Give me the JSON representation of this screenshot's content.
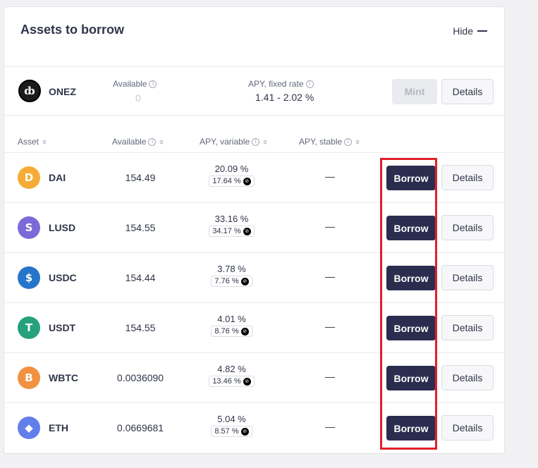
{
  "header": {
    "title": "Assets to borrow",
    "hide_label": "Hide"
  },
  "onez": {
    "symbol": "ONEZ",
    "logo_letter": "ȸ",
    "available_label": "Available",
    "available_value": "0",
    "apy_label": "APY, fixed rate",
    "apy_value": "1.41 - 2.02 %",
    "mint_label": "Mint",
    "details_label": "Details"
  },
  "columns": {
    "asset": "Asset",
    "available": "Available",
    "apy_variable": "APY, variable",
    "apy_stable": "APY, stable"
  },
  "rows": [
    {
      "symbol": "DAI",
      "available": "154.49",
      "apy": "20.09 %",
      "apy_badge": "17.64 %",
      "stable": "—",
      "borrow": "Borrow",
      "details": "Details",
      "icon_color": "#f5ac37",
      "icon_glyph": "D"
    },
    {
      "symbol": "LUSD",
      "available": "154.55",
      "apy": "33.16 %",
      "apy_badge": "34.17 %",
      "stable": "—",
      "borrow": "Borrow",
      "details": "Details",
      "icon_color": "#7b6bd8",
      "icon_glyph": "S"
    },
    {
      "symbol": "USDC",
      "available": "154.44",
      "apy": "3.78 %",
      "apy_badge": "7.76 %",
      "stable": "—",
      "borrow": "Borrow",
      "details": "Details",
      "icon_color": "#2775ca",
      "icon_glyph": "$"
    },
    {
      "symbol": "USDT",
      "available": "154.55",
      "apy": "4.01 %",
      "apy_badge": "8.76 %",
      "stable": "—",
      "borrow": "Borrow",
      "details": "Details",
      "icon_color": "#26a17b",
      "icon_glyph": "T"
    },
    {
      "symbol": "WBTC",
      "available": "0.0036090",
      "apy": "4.82 %",
      "apy_badge": "13.46 %",
      "stable": "—",
      "borrow": "Borrow",
      "details": "Details",
      "icon_color": "#f09242",
      "icon_glyph": "B"
    },
    {
      "symbol": "ETH",
      "available": "0.0669681",
      "apy": "5.04 %",
      "apy_badge": "8.57 %",
      "stable": "—",
      "borrow": "Borrow",
      "details": "Details",
      "icon_color": "#627eea",
      "icon_glyph": "◆"
    }
  ],
  "colors": {
    "borrow_button": "#2b2d4f",
    "highlight": "#e0202a"
  }
}
